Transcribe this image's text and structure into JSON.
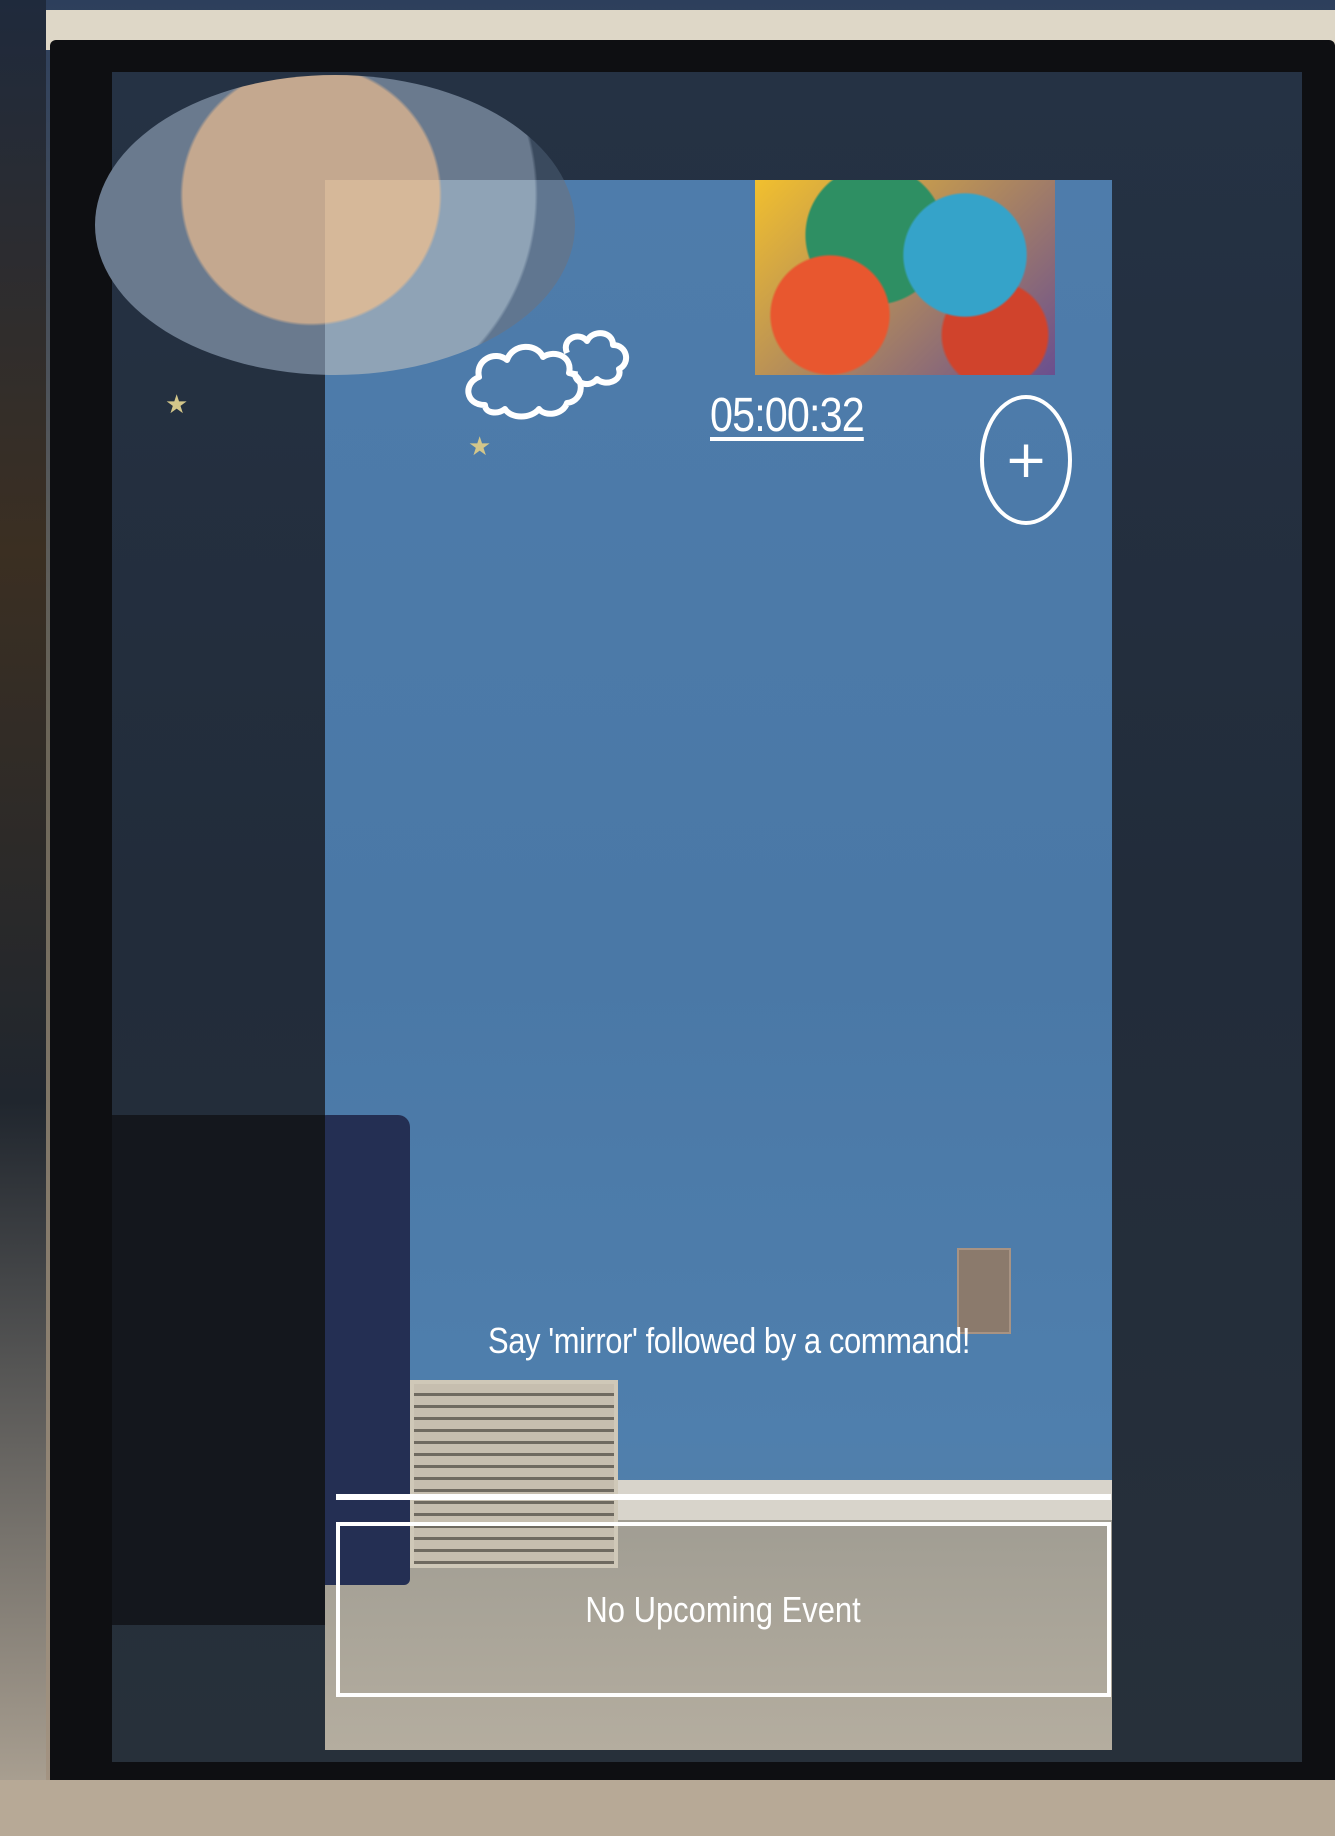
{
  "clock": {
    "time": "05:00:32"
  },
  "weather": {
    "icon": "cloudy-weather-icon"
  },
  "add_button": {
    "icon": "plus-icon",
    "symbol": "+"
  },
  "voice_assistant": {
    "hint": "Say 'mirror' followed by a command!"
  },
  "calendar": {
    "next_event": "No Upcoming Event"
  },
  "colors": {
    "ui_foreground": "#ffffff",
    "wall_reflection": "#4e7cab",
    "frame": "#0e0f12"
  }
}
